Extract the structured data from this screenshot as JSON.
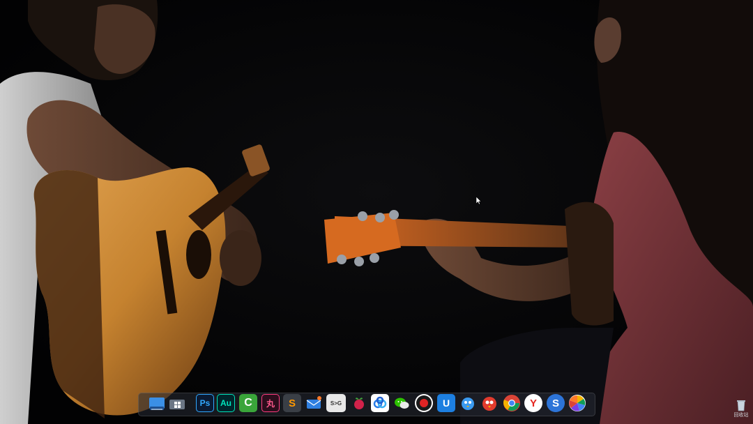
{
  "wallpaper": {
    "description_icon": "wallpaper-image"
  },
  "dock": {
    "items": [
      {
        "name": "finder-icon",
        "label": ""
      },
      {
        "name": "start-windows-icon",
        "label": ""
      },
      {
        "name": "photoshop-icon",
        "label": "Ps"
      },
      {
        "name": "audition-icon",
        "label": "Au"
      },
      {
        "name": "camtasia-icon",
        "label": "C"
      },
      {
        "name": "wps-icon",
        "label": "丸"
      },
      {
        "name": "sublime-text-icon",
        "label": "S"
      },
      {
        "name": "mail-icon",
        "label": ""
      },
      {
        "name": "s2g-icon",
        "label": "S>G"
      },
      {
        "name": "raspberry-icon",
        "label": ""
      },
      {
        "name": "baidu-netdisk-icon",
        "label": ""
      },
      {
        "name": "wechat-icon",
        "label": ""
      },
      {
        "name": "record-icon",
        "label": ""
      },
      {
        "name": "u-shield-icon",
        "label": "U"
      },
      {
        "name": "bird-icon",
        "label": ""
      },
      {
        "name": "angry-bird-icon",
        "label": ""
      },
      {
        "name": "chrome-icon",
        "label": ""
      },
      {
        "name": "yandex-browser-icon",
        "label": "Y"
      },
      {
        "name": "sogou-icon",
        "label": "S"
      },
      {
        "name": "photos-pinwheel-icon",
        "label": ""
      }
    ]
  },
  "desktop": {
    "recycle_bin_label": "回收站"
  },
  "colors": {
    "accent_dock": "#2b2f36",
    "cursor": "#ffffff"
  }
}
